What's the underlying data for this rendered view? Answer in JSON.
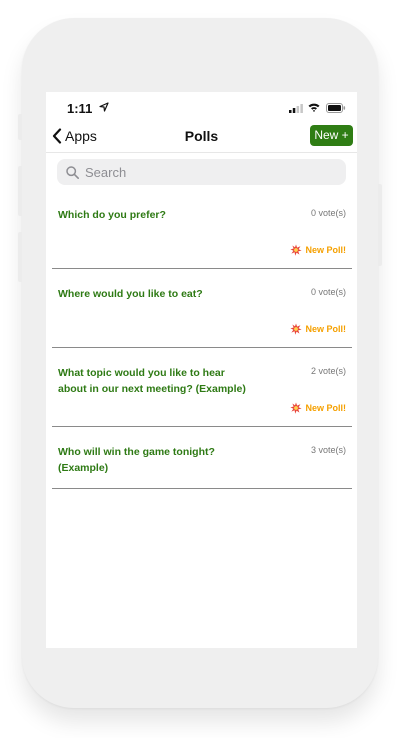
{
  "status_bar": {
    "time": "1:11"
  },
  "nav": {
    "back_label": "Apps",
    "title": "Polls",
    "new_label": "New +"
  },
  "search": {
    "placeholder": "Search"
  },
  "polls": [
    {
      "question": "Which do you prefer?",
      "votes": "0 vote(s)",
      "badge": "New Poll!"
    },
    {
      "question": "Where would you like to eat?",
      "votes": "0 vote(s)",
      "badge": "New Poll!"
    },
    {
      "question": "What topic would you like to hear about in our next meeting? (Example)",
      "votes": "2 vote(s)",
      "badge": "New Poll!"
    },
    {
      "question": "Who will win the game tonight? (Example)",
      "votes": "3 vote(s)"
    }
  ],
  "colors": {
    "accent": "#2f7d14",
    "question_text": "#2e7a14",
    "badge": "#f5a000"
  },
  "icons": [
    "location-arrow-icon",
    "signal-icon",
    "wifi-icon",
    "battery-icon",
    "chevron-left-icon",
    "search-icon",
    "new-poll-icon"
  ]
}
